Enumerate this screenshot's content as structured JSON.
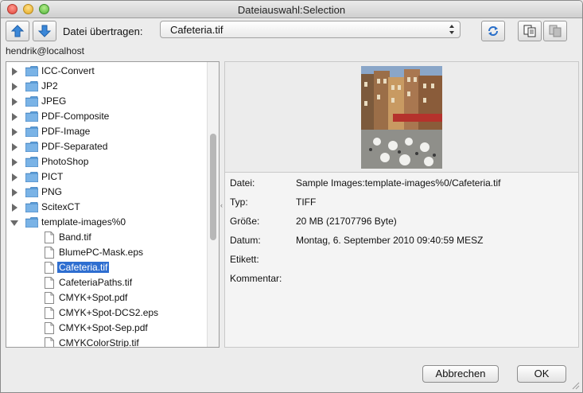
{
  "window": {
    "title": "Dateiauswahl:Selection"
  },
  "toolbar": {
    "up_icon": "arrow-up-icon",
    "down_icon": "arrow-down-icon",
    "transfer_label": "Datei übertragen:",
    "file_select_value": "Cafeteria.tif",
    "refresh_icon": "refresh-icon",
    "copy_icon": "copy-documents-icon",
    "paste_icon": "paste-documents-icon"
  },
  "host_label": "hendrik@localhost",
  "tree": {
    "folders": [
      {
        "label": "ICC-Convert",
        "expanded": false
      },
      {
        "label": "JP2",
        "expanded": false
      },
      {
        "label": "JPEG",
        "expanded": false
      },
      {
        "label": "PDF-Composite",
        "expanded": false
      },
      {
        "label": "PDF-Image",
        "expanded": false
      },
      {
        "label": "PDF-Separated",
        "expanded": false
      },
      {
        "label": "PhotoShop",
        "expanded": false
      },
      {
        "label": "PICT",
        "expanded": false
      },
      {
        "label": "PNG",
        "expanded": false
      },
      {
        "label": "ScitexCT",
        "expanded": false
      },
      {
        "label": "template-images%0",
        "expanded": true
      }
    ],
    "files": [
      {
        "label": "Band.tif",
        "selected": false
      },
      {
        "label": "BlumePC-Mask.eps",
        "selected": false
      },
      {
        "label": "Cafeteria.tif",
        "selected": true
      },
      {
        "label": "CafeteriaPaths.tif",
        "selected": false
      },
      {
        "label": "CMYK+Spot.pdf",
        "selected": false
      },
      {
        "label": "CMYK+Spot-DCS2.eps",
        "selected": false
      },
      {
        "label": "CMYK+Spot-Sep.pdf",
        "selected": false
      },
      {
        "label": "CMYKColorStrip.tif",
        "selected": false
      }
    ]
  },
  "info": {
    "rows": [
      {
        "key": "Datei:",
        "value": "Sample Images:template-images%0/Cafeteria.tif"
      },
      {
        "key": "Typ:",
        "value": "TIFF"
      },
      {
        "key": "Größe:",
        "value": "20 MB (21707796 Byte)"
      },
      {
        "key": "Datum:",
        "value": "Montag, 6. September 2010 09:40:59 MESZ"
      },
      {
        "key": "Etikett:",
        "value": ""
      },
      {
        "key": "Kommentar:",
        "value": ""
      }
    ]
  },
  "buttons": {
    "cancel": "Abbrechen",
    "ok": "OK"
  },
  "colors": {
    "selection": "#2e6ed0",
    "folder": "#5b9bd5",
    "arrow": "#3a87d8"
  }
}
